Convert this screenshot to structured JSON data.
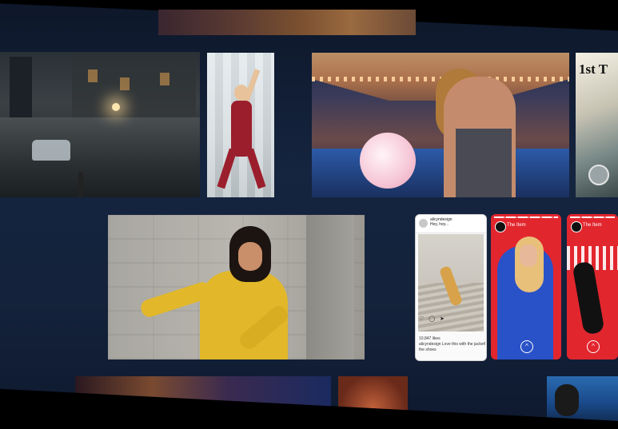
{
  "gallery": {
    "tiles": [
      {
        "id": "top-banner",
        "subject": "warm photo strip"
      },
      {
        "id": "rainy-street",
        "subject": "rainy night street with car"
      },
      {
        "id": "jumping-woman",
        "subject": "woman in red jumpsuit"
      },
      {
        "id": "cotton-candy",
        "subject": "woman eating cotton candy at fair"
      },
      {
        "id": "first-promo",
        "subject": "promo card"
      },
      {
        "id": "yellow-jacket",
        "subject": "woman in yellow jacket dancing"
      },
      {
        "id": "bottom-1",
        "subject": "colorful photo"
      },
      {
        "id": "bottom-2",
        "subject": "portrait"
      },
      {
        "id": "bottom-3",
        "subject": "blue photo"
      }
    ],
    "first_promo_text": "1st T"
  },
  "social_post": {
    "username": "alicyndesign",
    "caption_line1": "Hey, hey...",
    "likes": "10,847 likes",
    "comment": "alicyndesign Love this with the jacket! the shoes",
    "icons": "♡ ◯ ➤"
  },
  "stories": [
    {
      "account": "The Item",
      "up_icon": "^"
    },
    {
      "account": "The Item",
      "up_icon": "^"
    }
  ],
  "colors": {
    "background": "#14223d",
    "story_red": "#e2262e",
    "jacket_yellow": "#e2b82a"
  }
}
